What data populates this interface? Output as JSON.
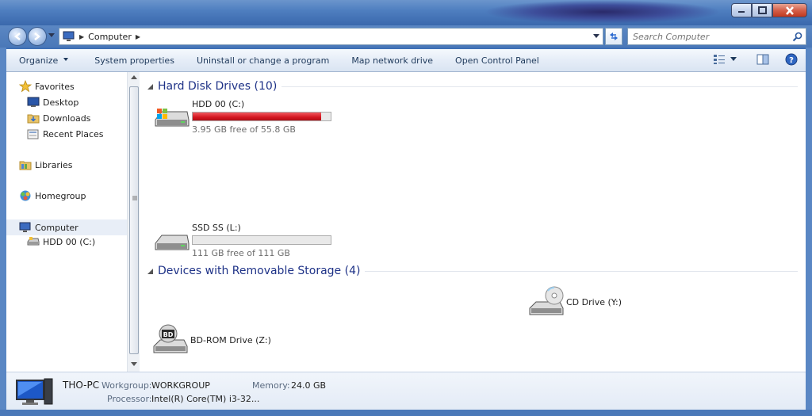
{
  "window": {
    "minimize_icon": "minimize-icon",
    "maximize_icon": "maximize-icon",
    "close_icon": "close-icon"
  },
  "address": {
    "crumb": "Computer",
    "search_placeholder": "Search Computer"
  },
  "toolbar": {
    "organize": "Organize",
    "system_properties": "System properties",
    "uninstall": "Uninstall or change a program",
    "map_network": "Map network drive",
    "control_panel": "Open Control Panel"
  },
  "nav": {
    "favorites": "Favorites",
    "desktop": "Desktop",
    "downloads": "Downloads",
    "recent_places": "Recent Places",
    "libraries": "Libraries",
    "homegroup": "Homegroup",
    "computer": "Computer",
    "hdd": "HDD 00 (C:)"
  },
  "groups": {
    "hdd_title": "Hard Disk Drives (10)",
    "removable_title": "Devices with Removable Storage (4)"
  },
  "drives": {
    "c": {
      "name": "HDD 00 (C:)",
      "free": "3.95 GB free of 55.8 GB",
      "used_fraction": 0.93
    },
    "l": {
      "name": "SSD SS (L:)",
      "free": "111 GB free of 111 GB",
      "used_fraction": 0.0
    },
    "y": {
      "name": "CD Drive (Y:)"
    },
    "z": {
      "name": "BD-ROM Drive (Z:)",
      "badge": "BD"
    }
  },
  "details": {
    "pc_name": "THO-PC",
    "workgroup_label": "Workgroup:",
    "workgroup_value": "WORKGROUP",
    "memory_label": "Memory:",
    "memory_value": "24.0 GB",
    "processor_label": "Processor:",
    "processor_value": "Intel(R) Core(TM) i3-32..."
  },
  "colors": {
    "bar_critical": "#d3151f",
    "group_title": "#1e3287",
    "toolbar_text": "#1e395b"
  }
}
